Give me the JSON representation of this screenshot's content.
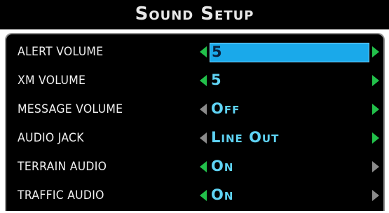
{
  "window": {
    "title": "Sound Setup"
  },
  "rows": [
    {
      "label": "ALERT VOLUME",
      "value": "5",
      "left_arrow": "green",
      "right_arrow": "green",
      "selected": true
    },
    {
      "label": "XM VOLUME",
      "value": "5",
      "left_arrow": "green",
      "right_arrow": "green",
      "selected": false
    },
    {
      "label": "MESSAGE VOLUME",
      "value": "Off",
      "left_arrow": "gray",
      "right_arrow": "green",
      "selected": false
    },
    {
      "label": "AUDIO JACK",
      "value": "Line Out",
      "left_arrow": "gray",
      "right_arrow": "green",
      "selected": false
    },
    {
      "label": "TERRAIN AUDIO",
      "value": "On",
      "left_arrow": "green",
      "right_arrow": "gray",
      "selected": false
    },
    {
      "label": "TRAFFIC AUDIO",
      "value": "On",
      "left_arrow": "green",
      "right_arrow": "gray",
      "selected": false
    }
  ],
  "colors": {
    "background": "#000000",
    "label_text": "#f0f0f0",
    "value_text": "#5fd3f4",
    "selection_fill": "#1aa9ea",
    "arrow_active": "#22c04a",
    "arrow_inactive": "#8a8a8a",
    "panel_border": "#8f8f8f"
  }
}
